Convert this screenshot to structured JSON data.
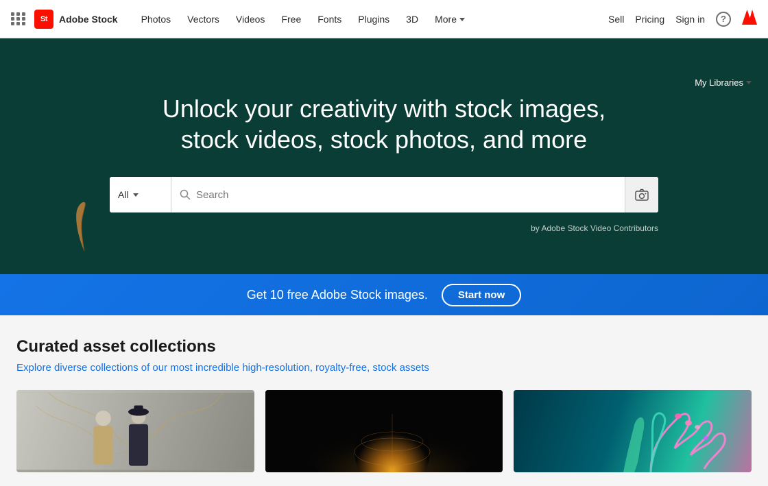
{
  "nav": {
    "grid_label": "apps-grid",
    "logo_badge": "St",
    "logo_text": "Adobe Stock",
    "links": [
      {
        "label": "Photos",
        "id": "photos"
      },
      {
        "label": "Vectors",
        "id": "vectors"
      },
      {
        "label": "Videos",
        "id": "videos"
      },
      {
        "label": "Free",
        "id": "free"
      },
      {
        "label": "Fonts",
        "id": "fonts"
      },
      {
        "label": "Plugins",
        "id": "plugins"
      },
      {
        "label": "3D",
        "id": "3d"
      },
      {
        "label": "More",
        "id": "more",
        "has_chevron": true
      }
    ],
    "right_links": [
      {
        "label": "Sell",
        "id": "sell"
      },
      {
        "label": "Pricing",
        "id": "pricing"
      },
      {
        "label": "Sign in",
        "id": "signin"
      }
    ],
    "help_label": "?",
    "adobe_icon": "A"
  },
  "hero": {
    "title": "Unlock your creativity with stock images, stock videos, stock photos, and more",
    "search_placeholder": "Search",
    "search_category": "All",
    "attribution": "by Adobe Stock Video Contributors",
    "my_libraries": "My Libraries"
  },
  "promo": {
    "text": "Get 10 free Adobe Stock images.",
    "button_label": "Start now"
  },
  "collections": {
    "title": "Curated asset collections",
    "subtitle": "Explore diverse collections of our most incredible high-resolution, royalty-free, stock assets",
    "cards": [
      {
        "id": "card-1",
        "alt": "Two women fashion photo"
      },
      {
        "id": "card-2",
        "alt": "Gold orb on dark background"
      },
      {
        "id": "card-3",
        "alt": "Neon colored hands"
      }
    ]
  }
}
